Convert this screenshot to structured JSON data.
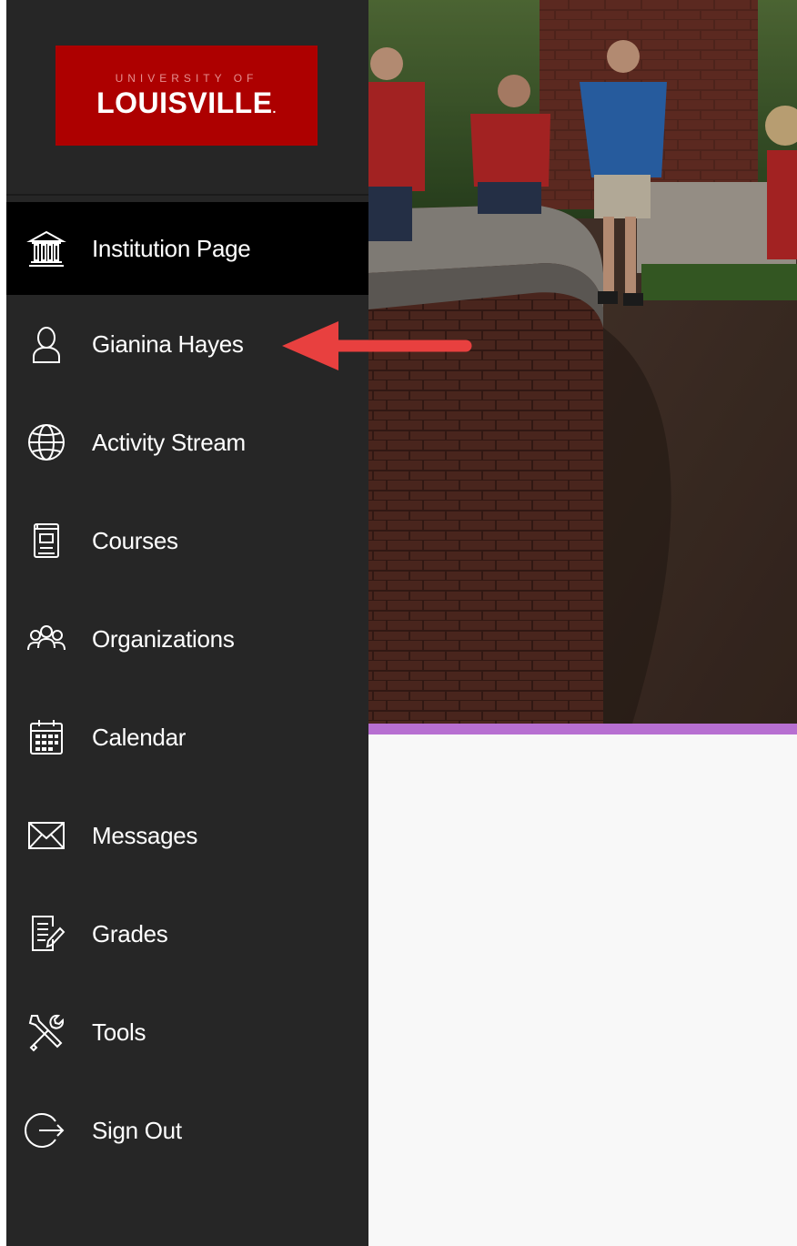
{
  "logo": {
    "line1": "UNIVERSITY OF",
    "line2": "LOUISVILLE",
    "line2_suffix": ".",
    "brand_color": "#ad0000"
  },
  "nav": {
    "items": [
      {
        "label": "Institution Page",
        "icon": "institution-icon",
        "active": true
      },
      {
        "label": "Gianina Hayes",
        "icon": "user-icon",
        "active": false
      },
      {
        "label": "Activity Stream",
        "icon": "globe-icon",
        "active": false
      },
      {
        "label": "Courses",
        "icon": "courses-icon",
        "active": false
      },
      {
        "label": "Organizations",
        "icon": "organizations-icon",
        "active": false
      },
      {
        "label": "Calendar",
        "icon": "calendar-icon",
        "active": false
      },
      {
        "label": "Messages",
        "icon": "envelope-icon",
        "active": false
      },
      {
        "label": "Grades",
        "icon": "grades-icon",
        "active": false
      },
      {
        "label": "Tools",
        "icon": "tools-icon",
        "active": false
      },
      {
        "label": "Sign Out",
        "icon": "sign-out-icon",
        "active": false
      }
    ]
  },
  "colors": {
    "sidebar_bg": "#262626",
    "active_bg": "#000000",
    "hero_accent": "#b76fd1",
    "annotation_arrow": "#e8403f"
  }
}
